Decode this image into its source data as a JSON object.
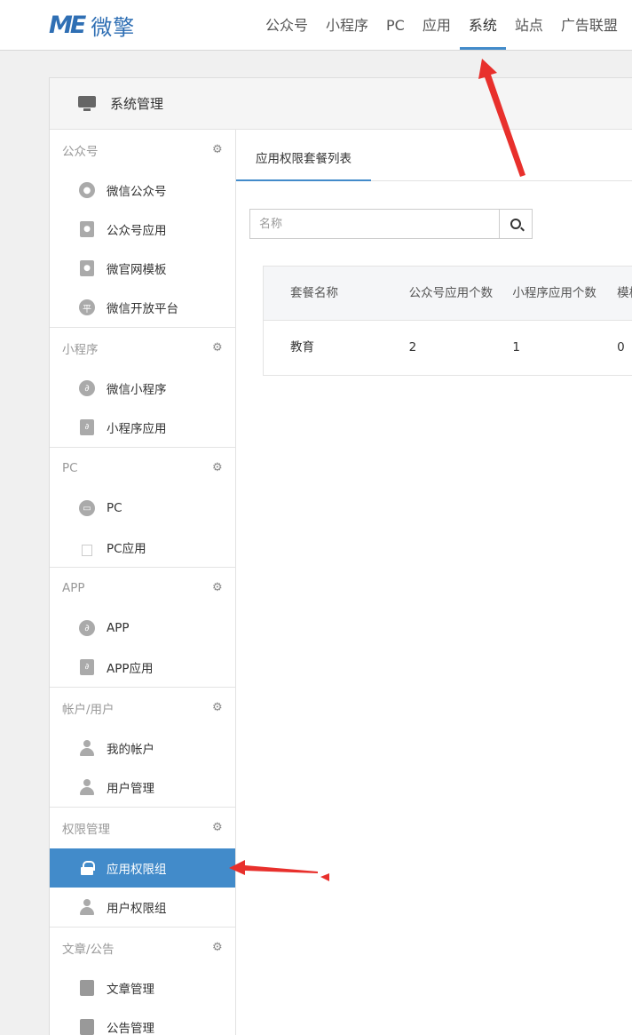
{
  "brand": {
    "mark": "ME",
    "name": "微擎"
  },
  "nav": [
    "公众号",
    "小程序",
    "PC",
    "应用",
    "系统",
    "站点",
    "广告联盟"
  ],
  "nav_active": "系统",
  "panel": {
    "title": "系统管理"
  },
  "sidebar": {
    "groups": [
      {
        "title": "公众号",
        "items": [
          "微信公众号",
          "公众号应用",
          "微官网模板",
          "微信开放平台"
        ]
      },
      {
        "title": "小程序",
        "items": [
          "微信小程序",
          "小程序应用"
        ]
      },
      {
        "title": "PC",
        "items": [
          "PC",
          "PC应用"
        ]
      },
      {
        "title": "APP",
        "items": [
          "APP",
          "APP应用"
        ]
      },
      {
        "title": "帐户/用户",
        "items": [
          "我的帐户",
          "用户管理"
        ]
      },
      {
        "title": "权限管理",
        "items": [
          "应用权限组",
          "用户权限组"
        ]
      },
      {
        "title": "文章/公告",
        "items": [
          "文章管理",
          "公告管理"
        ]
      }
    ],
    "active_item": "应用权限组"
  },
  "content": {
    "tab": "应用权限套餐列表",
    "search": {
      "placeholder": "名称"
    },
    "table": {
      "headers": [
        "套餐名称",
        "公众号应用个数",
        "小程序应用个数",
        "模板"
      ],
      "rows": [
        [
          "教育",
          "2",
          "1",
          "0"
        ]
      ]
    }
  },
  "colors": {
    "accent": "#428bca",
    "brand": "#2f6fb4",
    "annotation": "#e8302c"
  }
}
